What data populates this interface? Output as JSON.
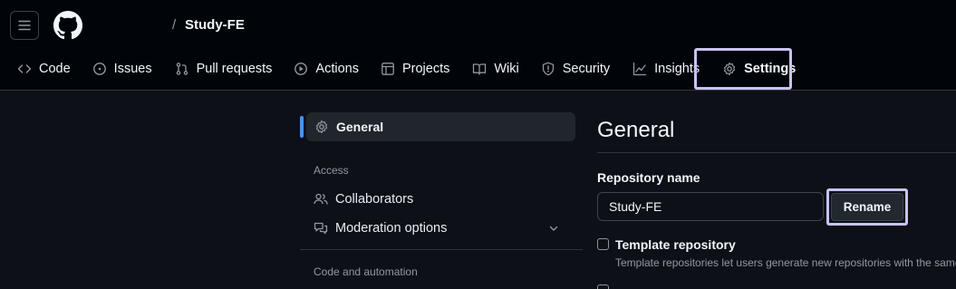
{
  "header": {
    "menu_icon": "hamburger-icon",
    "logo_icon": "github-mark-icon",
    "breadcrumb_separator": "/",
    "repo_name": "Study-FE"
  },
  "tabs": [
    {
      "label": "Code",
      "icon": "code-icon"
    },
    {
      "label": "Issues",
      "icon": "issue-circle-icon"
    },
    {
      "label": "Pull requests",
      "icon": "pull-request-icon"
    },
    {
      "label": "Actions",
      "icon": "play-icon"
    },
    {
      "label": "Projects",
      "icon": "table-icon"
    },
    {
      "label": "Wiki",
      "icon": "book-icon"
    },
    {
      "label": "Security",
      "icon": "shield-icon"
    },
    {
      "label": "Insights",
      "icon": "graph-icon"
    },
    {
      "label": "Settings",
      "icon": "gear-icon",
      "active": true
    }
  ],
  "sidebar": {
    "general": "General",
    "access_heading": "Access",
    "collaborators": "Collaborators",
    "moderation": "Moderation options",
    "code_heading": "Code and automation"
  },
  "main": {
    "title": "General",
    "repo_name_label": "Repository name",
    "repo_name_value": "Study-FE",
    "rename_button": "Rename",
    "template_label": "Template repository",
    "template_help": "Template repositories let users generate new repositories with the same"
  },
  "colors": {
    "background": "#0d1117",
    "header_background": "#010409",
    "accent": "#4493f8",
    "highlight": "#c9c1f0"
  }
}
